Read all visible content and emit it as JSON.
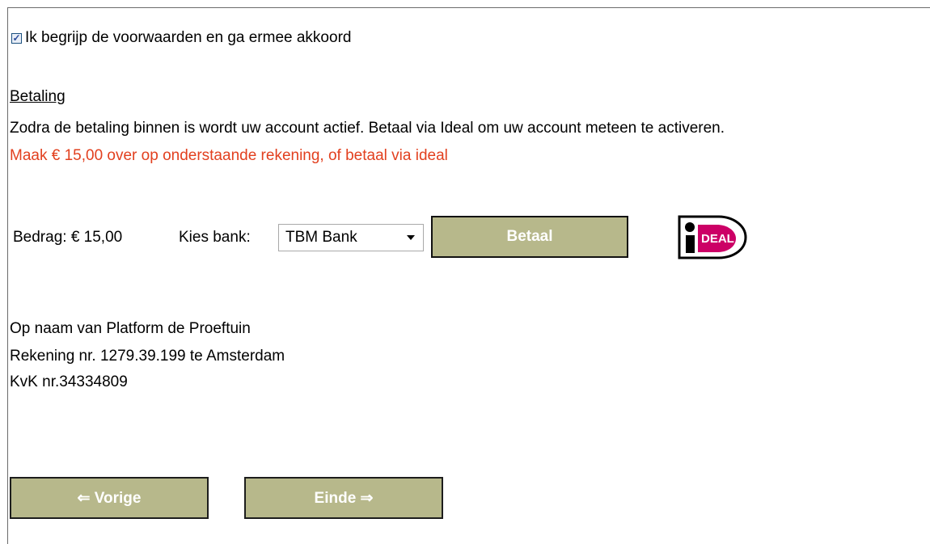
{
  "terms": {
    "checked": true,
    "label": "Ik begrijp de voorwaarden en ga ermee akkoord"
  },
  "payment": {
    "section_title": "Betaling",
    "intro": "Zodra de betaling binnen is wordt uw account actief. Betaal via Ideal om uw account meteen te activeren.",
    "notice": "Maak € 15,00 over op onderstaande rekening, of betaal via ideal",
    "amount": "Bedrag: € 15,00",
    "bank_label": "Kies bank:",
    "bank_selected": "TBM Bank",
    "pay_button": "Betaal",
    "logo": {
      "icon": "ideal-logo",
      "text": "DEAL",
      "accent_color": "#cc0066"
    }
  },
  "account": {
    "name": "Op naam van Platform de Proeftuin",
    "number": "Rekening nr. 1279.39.199 te Amsterdam",
    "kvk": "KvK nr.34334809"
  },
  "navigation": {
    "previous": "⇐ Vorige",
    "finish": "Einde ⇒"
  },
  "colors": {
    "button_background": "#b7b88b",
    "notice_text": "#e2401f"
  }
}
